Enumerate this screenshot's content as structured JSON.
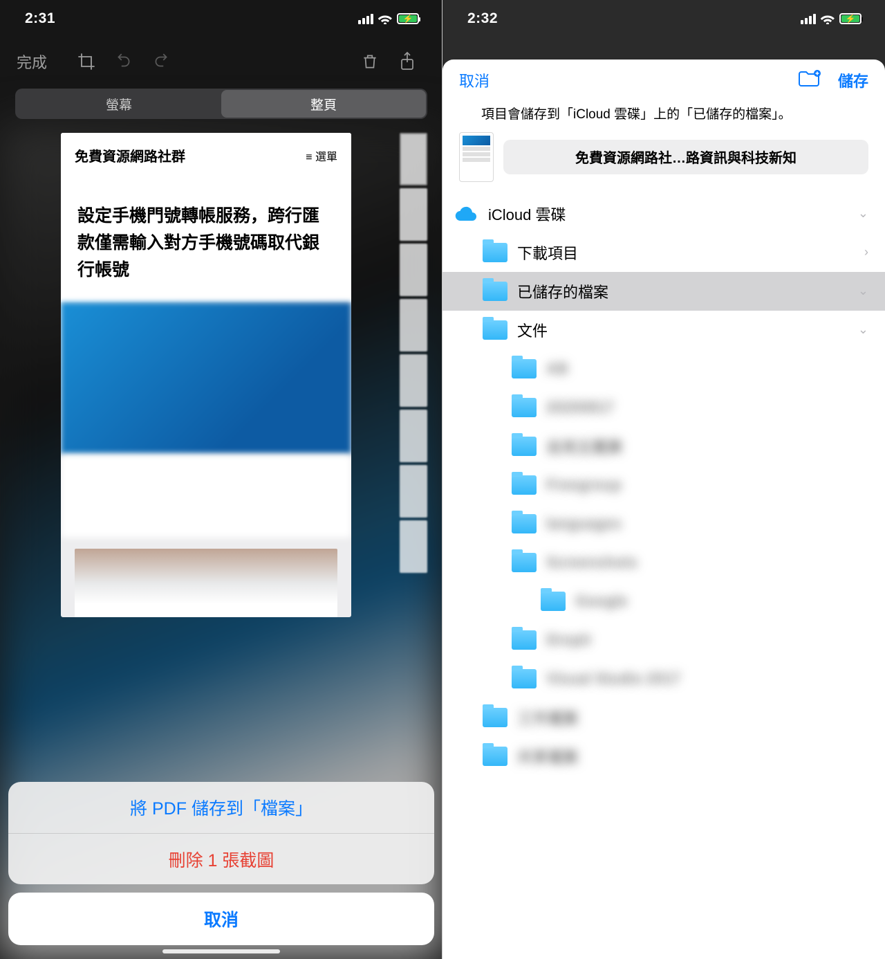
{
  "left": {
    "status_time": "2:31",
    "editbar": {
      "done": "完成"
    },
    "segmented": {
      "screen": "螢幕",
      "fullpage": "整頁"
    },
    "page": {
      "site_title": "免費資源網路社群",
      "menu": "≡ 選單",
      "article_title": "設定手機門號轉帳服務，跨行匯款僅需輸入對方手機號碼取代銀行帳號"
    },
    "sheet": {
      "save_pdf": "將 PDF 儲存到「檔案」",
      "delete": "刪除 1 張截圖",
      "cancel": "取消"
    }
  },
  "right": {
    "status_time": "2:32",
    "toolbar": {
      "cancel": "取消",
      "save": "儲存"
    },
    "info": "項目會儲存到「iCloud 雲碟」上的「已儲存的檔案」。",
    "doc_name": "免費資源網路社…路資訊與科技新知",
    "folders": {
      "icloud": "iCloud 雲碟",
      "downloads": "下載項目",
      "saved": "已儲存的檔案",
      "documents": "文件"
    }
  }
}
